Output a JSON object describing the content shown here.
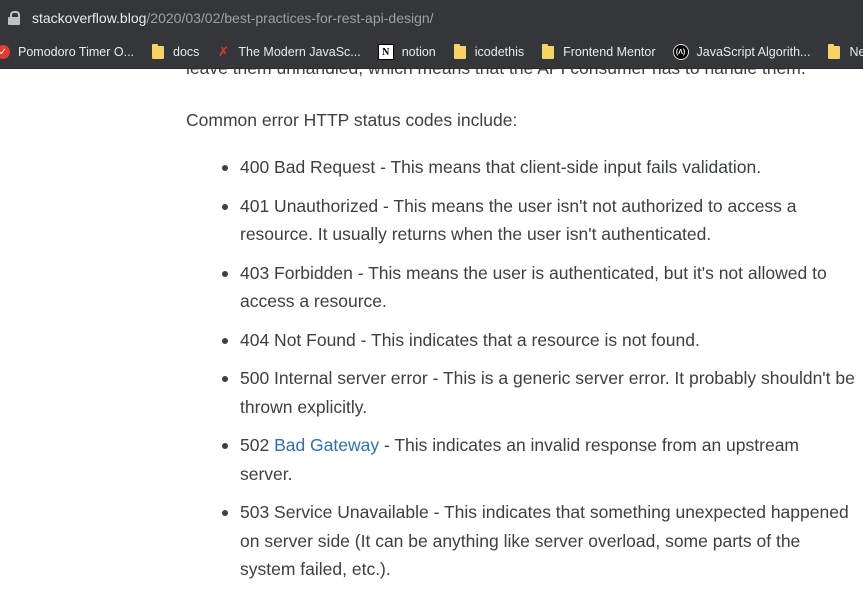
{
  "address_bar": {
    "domain": "stackoverflow.blog",
    "path": "/2020/03/02/best-practices-for-rest-api-design/"
  },
  "bookmarks": [
    {
      "label": "Pomodoro Timer O...",
      "icon": "check-icon"
    },
    {
      "label": "docs",
      "icon": "folder-icon"
    },
    {
      "label": "The Modern JavaSc...",
      "icon": "modern-javascript-icon"
    },
    {
      "label": "notion",
      "icon": "notion-icon"
    },
    {
      "label": "icodethis",
      "icon": "folder-icon"
    },
    {
      "label": "Frontend Mentor",
      "icon": "folder-icon"
    },
    {
      "label": "JavaScript Algorith...",
      "icon": "algorithms-icon"
    },
    {
      "label": "NeogC",
      "icon": "folder-icon"
    }
  ],
  "article": {
    "cut_line": "leave them unhandled, which means that the API consumer has to handle them.",
    "intro": "Common error HTTP status codes include:",
    "items": [
      {
        "text": "400 Bad Request - This means that client-side input fails validation."
      },
      {
        "text": "401 Unauthorized - This means the user isn't not authorized to access a resource. It usually returns when the user isn't authenticated."
      },
      {
        "text": "403 Forbidden - This means the user is authenticated, but it's not allowed to access a resource."
      },
      {
        "text": "404 Not Found - This indicates that a resource is not found."
      },
      {
        "text": "500 Internal server error - This is a generic server error. It probably shouldn't be thrown explicitly."
      },
      {
        "prefix": "502 ",
        "link": "Bad Gateway",
        "suffix": " - This indicates an invalid response from an upstream server."
      },
      {
        "text": "503 Service Unavailable - This indicates that something unexpected happened on server side (It can be anything like server overload, some parts of the system failed, etc.)."
      }
    ]
  }
}
